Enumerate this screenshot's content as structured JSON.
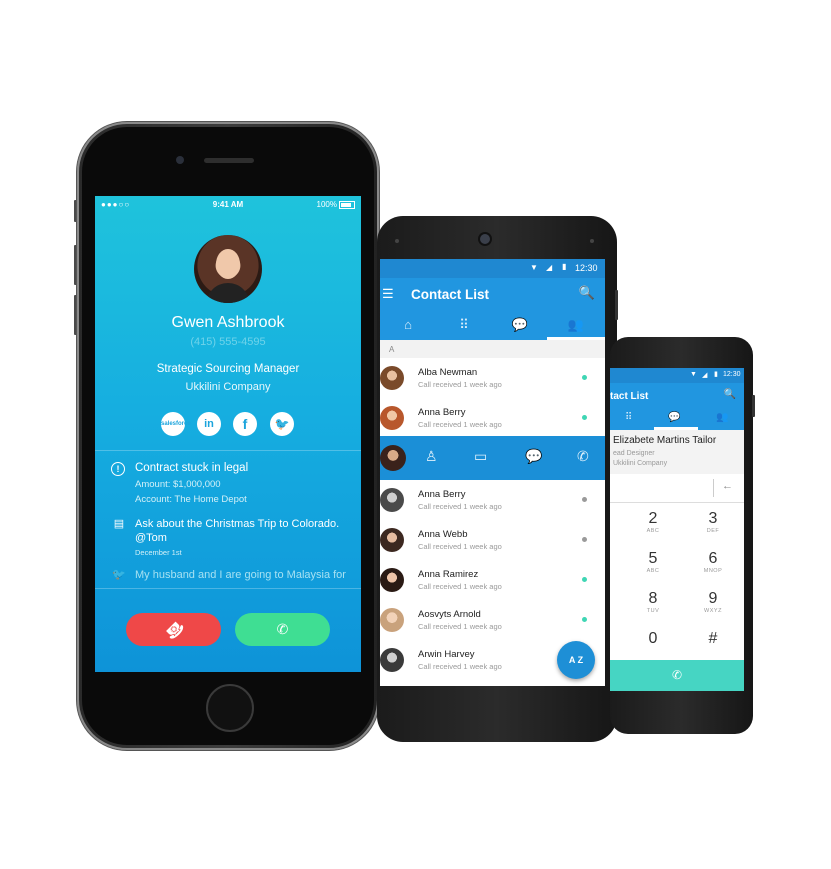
{
  "caller": {
    "status_time": "9:41 AM",
    "status_carrier": "●●●○○",
    "status_battery": "100%",
    "name": "Gwen Ashbrook",
    "phone": "(415) 555-4595",
    "role": "Strategic Sourcing Manager",
    "company": "Ukkilini Company",
    "social": [
      {
        "label": "salesforce"
      },
      {
        "label": "in"
      },
      {
        "label": "f"
      },
      {
        "label": "🐦"
      }
    ],
    "feed": [
      {
        "title": "Contract stuck in legal",
        "line1": "Amount: $1,000,000",
        "line2": "Account: The Home Depot"
      },
      {
        "text": "Ask about the Christmas Trip to Colorado. @Tom",
        "date": "December 1st"
      },
      {
        "text": "My husband and I are going to Malaysia for"
      }
    ],
    "decline_icon": "☎",
    "accept_icon": "✆"
  },
  "contact_list": {
    "status_time": "12:30",
    "title": "Contact List",
    "section": "A",
    "contacts": [
      {
        "name": "Alba Newman",
        "sub": "Call received 1 week ago",
        "status": "#3fd6b4"
      },
      {
        "name": "Anna Berry",
        "sub": "Call received 1 week ago",
        "status": "#3fd6b4"
      },
      {
        "name": "Anna Berry",
        "sub": "Call received 1 week ago",
        "status": "#9a9a9a"
      },
      {
        "name": "Anna Webb",
        "sub": "Call received 1 week ago",
        "status": "#9a9a9a"
      },
      {
        "name": "Anna Ramirez",
        "sub": "Call received 1 week ago",
        "status": "#3fd6b4"
      },
      {
        "name": "Aosvyts Arnold",
        "sub": "Call received 1 week ago",
        "status": "#3fd6b4"
      },
      {
        "name": "Arwin Harvey",
        "sub": "Call received 1 week ago",
        "status": "#3fd6b4"
      }
    ],
    "fab_label": "A Z"
  },
  "dialer": {
    "status_time": "12:30",
    "title": "tact List",
    "contact_name": "Elizabete Martins Tailor",
    "contact_role": "ead Designer",
    "contact_company": "Ukkilini Company",
    "backspace": "←",
    "keys": [
      {
        "digit": "2",
        "letters": "ABC"
      },
      {
        "digit": "3",
        "letters": "DEF"
      },
      {
        "digit": "5",
        "letters": "ABC"
      },
      {
        "digit": "6",
        "letters": "MNOP"
      },
      {
        "digit": "8",
        "letters": "TUV"
      },
      {
        "digit": "9",
        "letters": "WXYZ"
      },
      {
        "digit": "0",
        "letters": ""
      },
      {
        "digit": "#",
        "letters": ""
      }
    ]
  },
  "colors": {
    "accent_blue": "#2196e0",
    "decline_red": "#ef4848",
    "accept_green": "#3fde93",
    "teal": "#46d5c3"
  }
}
